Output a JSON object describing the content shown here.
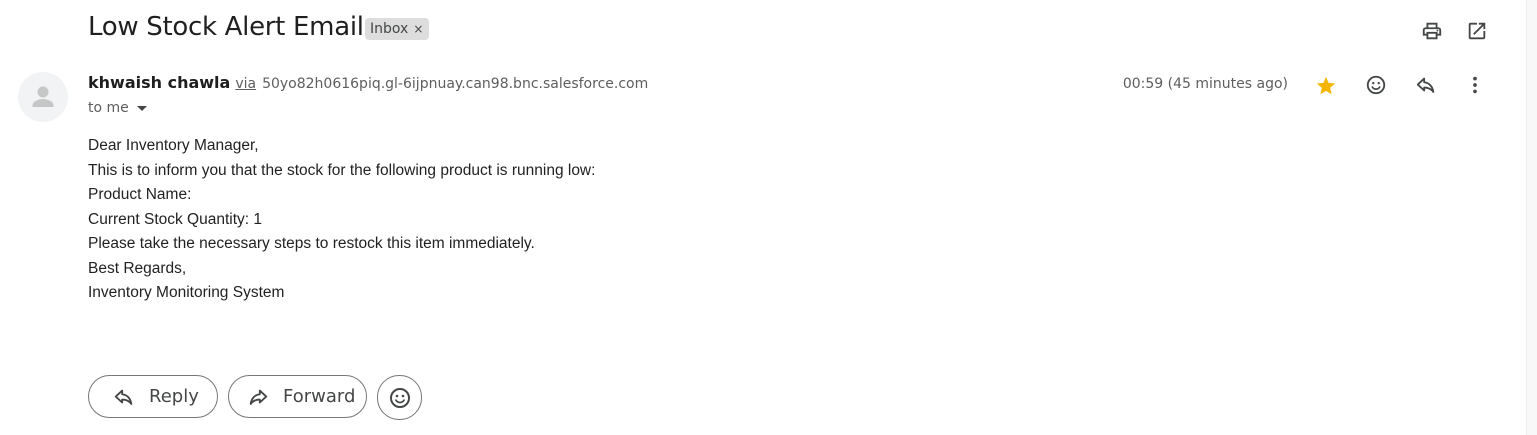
{
  "email": {
    "subject": "Low Stock Alert Email",
    "label": "Inbox",
    "label_remove": "×"
  },
  "toolbar": {
    "print_icon": "printer-icon",
    "popout_icon": "open-in-new-window-icon"
  },
  "sender": {
    "name": "khwaish chawla",
    "via_label": "via",
    "via_domain": "50yo82h0616piq.gl-6ijpnuay.can98.bnc.salesforce.com",
    "recipient_label": "to me",
    "timestamp": "00:59 (45 minutes ago)",
    "starred": true,
    "star_color": "#f4b400"
  },
  "message": {
    "lines": [
      "Dear Inventory Manager,",
      "This is to inform you that the stock for the following product is running low:",
      "Product Name:",
      "Current Stock Quantity: 1",
      "Please take the necessary steps to restock this item immediately.",
      "Best Regards,",
      "Inventory Monitoring System"
    ]
  },
  "actions": {
    "reply_label": "Reply",
    "forward_label": "Forward",
    "emoji_icon": "add-emoji-reaction-icon"
  }
}
